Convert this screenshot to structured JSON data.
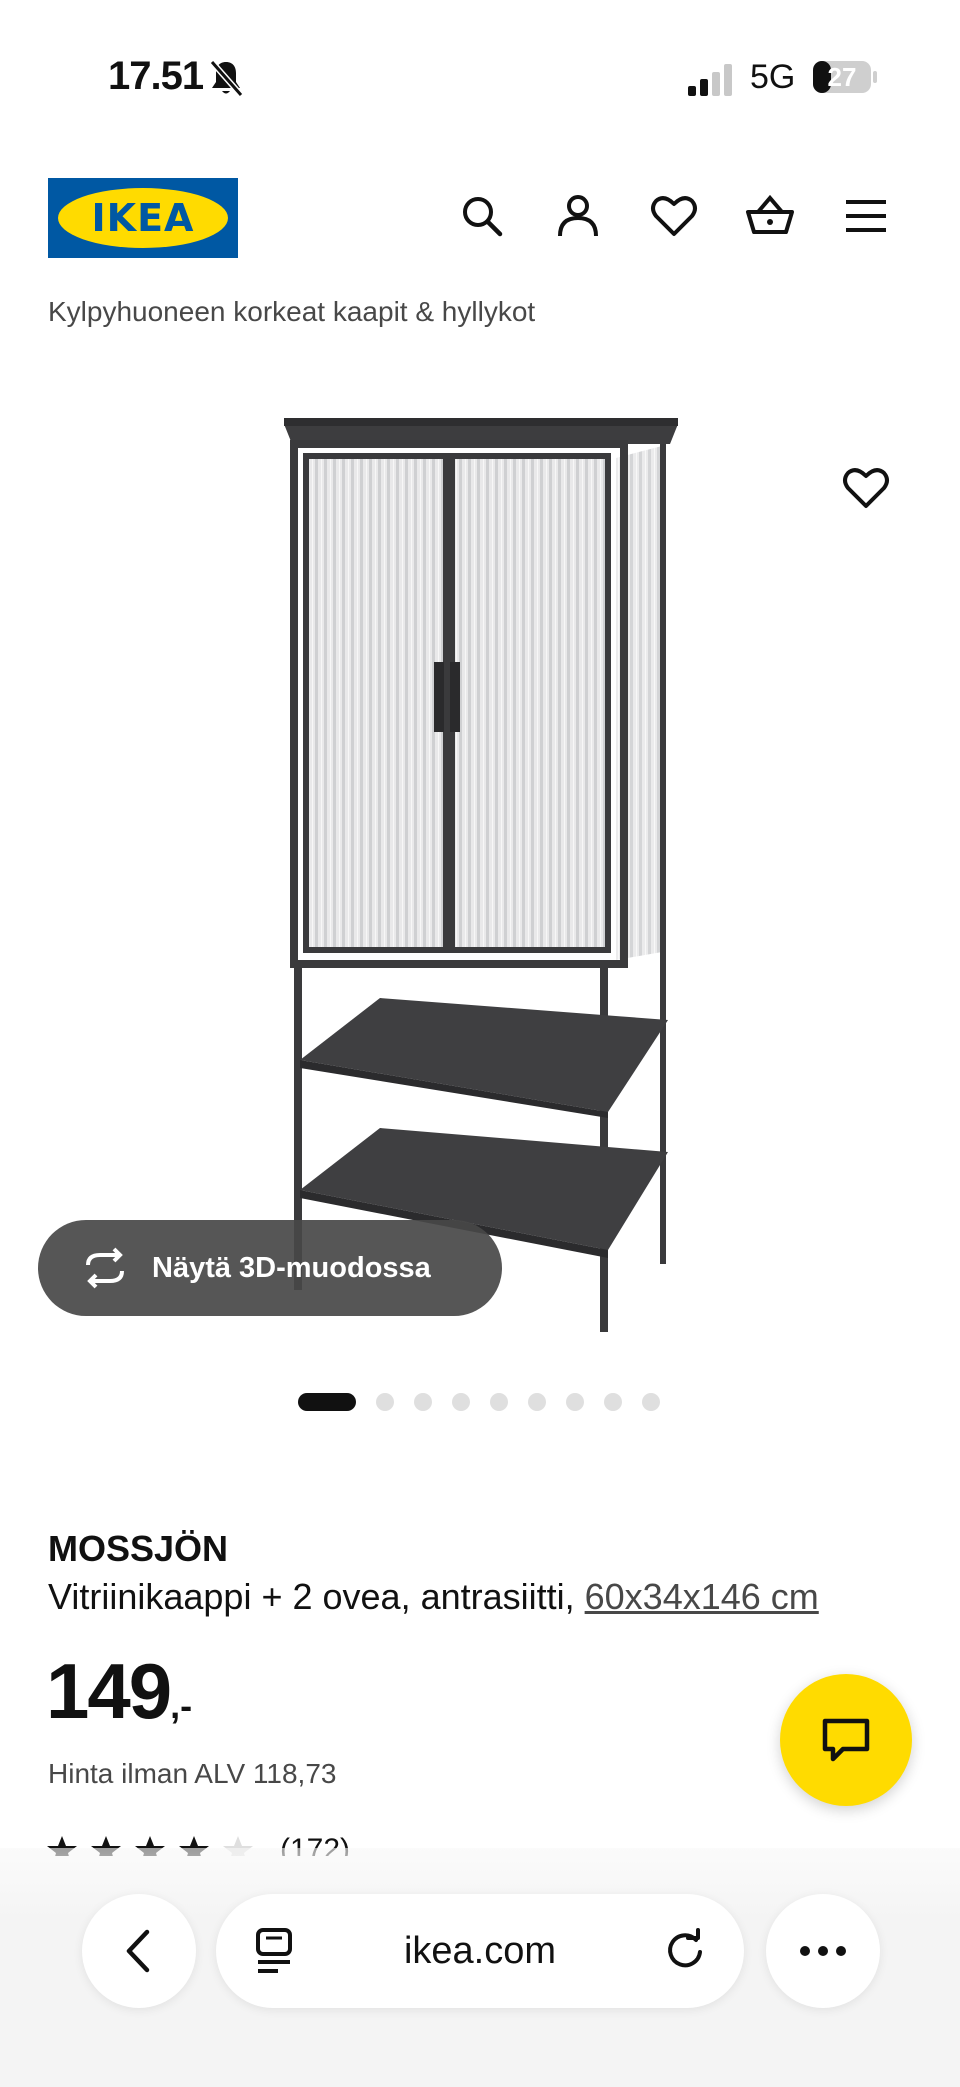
{
  "status_bar": {
    "time": "17.51",
    "network": "5G",
    "battery": "27"
  },
  "header": {
    "logo_text": "IKEA",
    "icons": [
      "search-icon",
      "account-icon",
      "wishlist-icon",
      "basket-icon",
      "menu-icon"
    ]
  },
  "breadcrumb": "Kylpyhuoneen korkeat kaapit & hyllykot",
  "gallery": {
    "view_3d_label": "Näytä 3D-muodossa",
    "image_count": 9,
    "active_index": 0
  },
  "product": {
    "name": "MOSSJÖN",
    "description": "Vitriinikaappi + 2 ovea, antrasiitti, ",
    "dimensions": "60x34x146 cm",
    "price": "149",
    "price_suffix": ",-",
    "price_no_vat": "Hinta ilman ALV 118,73",
    "rating": 4,
    "rating_max": 5,
    "review_count": "(172)"
  },
  "browser": {
    "url": "ikea.com"
  },
  "colors": {
    "ikea_blue": "#0058a3",
    "ikea_yellow": "#ffdb00",
    "overlay_dark": "#484848"
  }
}
